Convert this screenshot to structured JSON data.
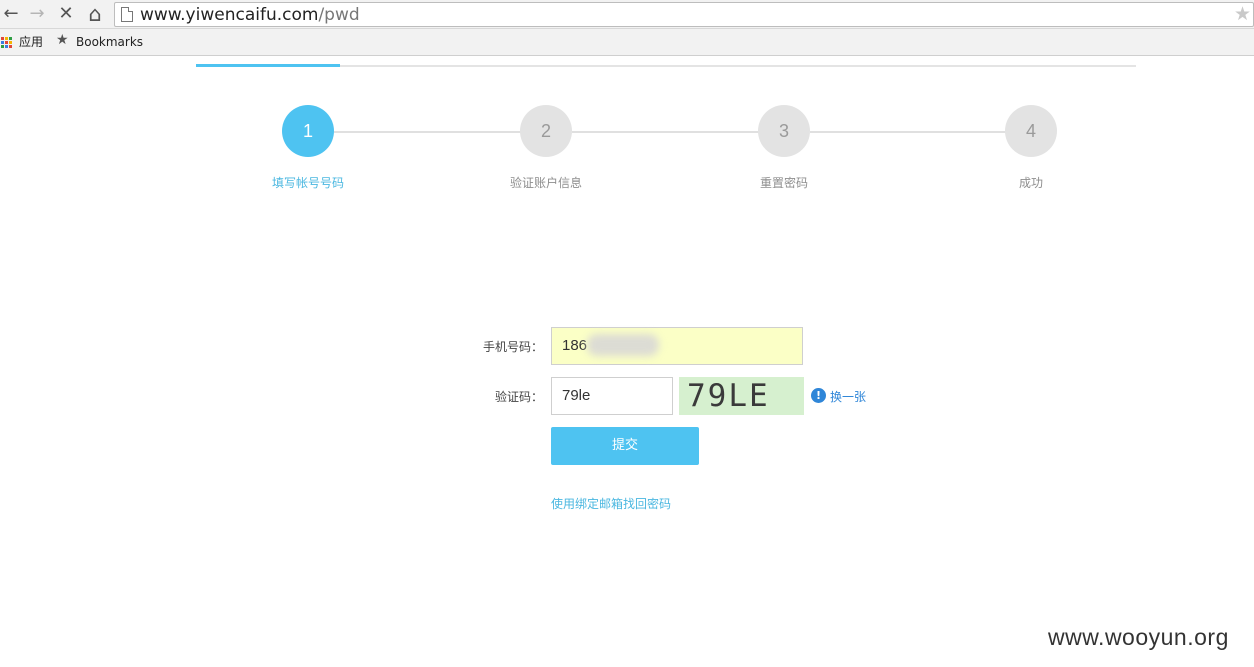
{
  "browser": {
    "back_icon": "←",
    "forward_icon": "→",
    "stop_icon": "✕",
    "home_icon": "⌂",
    "url_host": "www.yiwencaifu.com",
    "url_path": "/pwd",
    "star_icon": "★",
    "bookmarks": {
      "apps_label": "应用",
      "bookmarks_label": "Bookmarks",
      "bookmarks_star": "★"
    }
  },
  "steps": [
    {
      "number": "1",
      "label": "填写帐号号码",
      "active": true
    },
    {
      "number": "2",
      "label": "验证账户信息",
      "active": false
    },
    {
      "number": "3",
      "label": "重置密码",
      "active": false
    },
    {
      "number": "4",
      "label": "成功",
      "active": false
    }
  ],
  "form": {
    "phone_label": "手机号码：",
    "phone_value": "186",
    "captcha_label": "验证码：",
    "captcha_value": "79le",
    "captcha_image_text": "79LE",
    "info_icon": "!",
    "refresh_label": "换一张",
    "submit_label": "提交",
    "email_recover_link": "使用绑定邮箱找回密码"
  },
  "watermark": "www.wooyun.org",
  "colors": {
    "accent": "#4ec3f1",
    "link": "#2f86d8",
    "phone_bg": "#fbffc6",
    "captcha_bg": "#d6f0cf"
  }
}
